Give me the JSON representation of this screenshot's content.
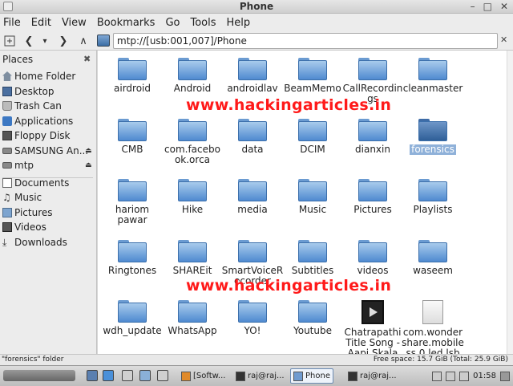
{
  "window": {
    "title": "Phone"
  },
  "titlebar_buttons": [
    "–",
    "□",
    "✕"
  ],
  "menu": [
    "File",
    "Edit",
    "View",
    "Bookmarks",
    "Go",
    "Tools",
    "Help"
  ],
  "toolbar": {
    "new_tab_icon": "new-tab-icon",
    "back": "❮",
    "back_dropdown": "▾",
    "forward": "❯",
    "up": "∧",
    "path": "mtp://[usb:001,007]/Phone",
    "close": "✕"
  },
  "sidebar": {
    "header": "Places",
    "close": "✖",
    "items": [
      {
        "label": "Home Folder",
        "icon": "home-icon"
      },
      {
        "label": "Desktop",
        "icon": "desktop-icon"
      },
      {
        "label": "Trash Can",
        "icon": "trash-icon"
      },
      {
        "label": "Applications",
        "icon": "applications-icon"
      },
      {
        "label": "Floppy Disk",
        "icon": "floppy-icon"
      },
      {
        "label": "SAMSUNG An...",
        "icon": "drive-icon",
        "eject": "⏏"
      },
      {
        "label": "mtp",
        "icon": "drive-icon",
        "eject": "⏏"
      }
    ],
    "bookmarks": [
      {
        "label": "Documents",
        "icon": "documents-icon"
      },
      {
        "label": "Music",
        "icon": "music-icon",
        "glyph": "♫"
      },
      {
        "label": "Pictures",
        "icon": "pictures-icon"
      },
      {
        "label": "Videos",
        "icon": "videos-icon"
      },
      {
        "label": "Downloads",
        "icon": "downloads-icon",
        "glyph": "⤓"
      }
    ]
  },
  "files": [
    [
      "airdroid",
      "Android",
      "androidlav",
      "BeamMemo",
      "CallRecordin\ngs",
      "cleanmaster"
    ],
    [
      "CMB",
      "com.facebo\nok.orca",
      "data",
      "DCIM",
      "dianxin",
      "forensics"
    ],
    [
      "hariom\npawar",
      "Hike",
      "media",
      "Music",
      "Pictures",
      "Playlists"
    ],
    [
      "Ringtones",
      "SHAREit",
      "SmartVoiceR\necorder",
      "Subtitles",
      "videos",
      "waseem"
    ],
    [
      "wdh_update",
      "WhatsApp",
      "YO!",
      "Youtube",
      "Chatrapathi\nTitle Song -\nAapi Skala",
      "com.wonder\nshare.mobile\nss.0.led.lsb"
    ]
  ],
  "selected_file": "forensics",
  "watermark": "www.hackingarticles.in",
  "status": {
    "left": "\"forensics\" folder",
    "right": "Free space: 15.7 GiB (Total: 25.9 GiB)"
  },
  "taskbar": {
    "items": [
      "[Softw...",
      "raj@raj...",
      "Phone",
      "raj@raj..."
    ],
    "active": "Phone",
    "clock": "01:58"
  }
}
